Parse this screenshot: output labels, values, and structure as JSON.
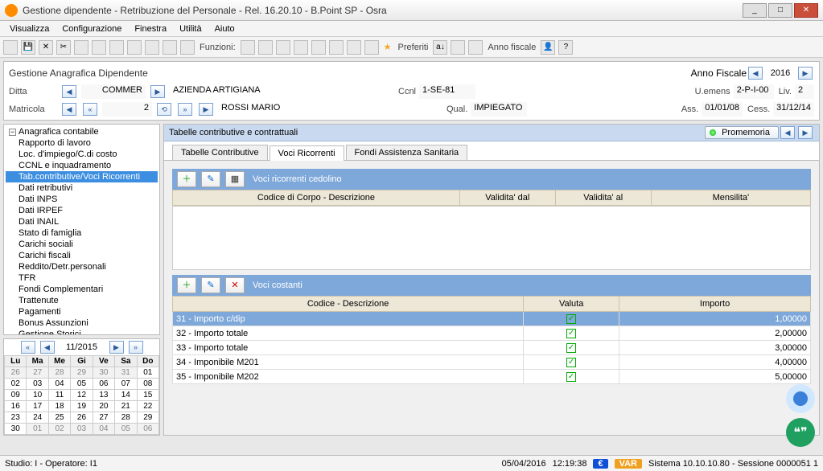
{
  "window": {
    "title": "Gestione dipendente - Retribuzione del Personale - Rel. 16.20.10 - B.Point SP - Osra"
  },
  "menu": {
    "items": [
      "Visualizza",
      "Configurazione",
      "Finestra",
      "Utilità",
      "Aiuto"
    ]
  },
  "toolbar": {
    "funzioni": "Funzioni:",
    "preferiti": "Preferiti",
    "anno_fiscale": "Anno fiscale"
  },
  "header": {
    "title": "Gestione Anagrafica Dipendente",
    "anno_label": "Anno Fiscale",
    "anno_value": "2016",
    "ditta_label": "Ditta",
    "ditta_code": "COMMER",
    "ditta_name": "AZIENDA ARTIGIANA",
    "ccnl_label": "Ccnl",
    "ccnl_value": "1-SE-81",
    "uemens_label": "U.emens",
    "uemens_value": "2-P-I-00",
    "liv_label": "Liv.",
    "liv_value": "2",
    "matricola_label": "Matricola",
    "matricola_value": "2",
    "nome": "ROSSI MARIO",
    "qual_label": "Qual.",
    "qual_value": "IMPIEGATO",
    "ass_label": "Ass.",
    "ass_value": "01/01/08",
    "cess_label": "Cess.",
    "cess_value": "31/12/14"
  },
  "tree": {
    "root": "Anagrafica contabile",
    "items": [
      "Rapporto di lavoro",
      "Loc. d'impiego/C.di costo",
      "CCNL e inquadramento",
      "Tab.contributive/Voci Ricorrenti",
      "Dati retributivi",
      "Dati INPS",
      "Dati IRPEF",
      "Dati INAIL",
      "Stato di famiglia",
      "Carichi sociali",
      "Carichi fiscali",
      "Reddito/Detr.personali",
      "TFR",
      "Fondi Complementari",
      "Trattenute",
      "Pagamenti",
      "Bonus Assunzioni",
      "Gestione Storici"
    ],
    "selected_index": 3
  },
  "calendar": {
    "month": "11/2015",
    "days": [
      "Lu",
      "Ma",
      "Me",
      "Gi",
      "Ve",
      "Sa",
      "Do"
    ],
    "rows": [
      [
        "26",
        "27",
        "28",
        "29",
        "30",
        "31",
        "01"
      ],
      [
        "02",
        "03",
        "04",
        "05",
        "06",
        "07",
        "08"
      ],
      [
        "09",
        "10",
        "11",
        "12",
        "13",
        "14",
        "15"
      ],
      [
        "16",
        "17",
        "18",
        "19",
        "20",
        "21",
        "22"
      ],
      [
        "23",
        "24",
        "25",
        "26",
        "27",
        "28",
        "29"
      ],
      [
        "30",
        "01",
        "02",
        "03",
        "04",
        "05",
        "06"
      ]
    ]
  },
  "panel": {
    "title": "Tabelle contributive e contrattuali",
    "promemoria": "Promemoria",
    "tabs": [
      "Tabelle Contributive",
      "Voci Ricorrenti",
      "Fondi Assistenza Sanitaria"
    ],
    "active_tab": 1,
    "sub1": {
      "title": "Voci ricorrenti cedolino",
      "cols": [
        "Codice di Corpo - Descrizione",
        "Validita' dal",
        "Validita' al",
        "Mensilita'"
      ]
    },
    "sub2": {
      "title": "Voci costanti",
      "cols": [
        "Codice - Descrizione",
        "Valuta",
        "Importo"
      ],
      "rows": [
        {
          "desc": "31 - Importo c/dip",
          "valuta": true,
          "importo": "1,00000"
        },
        {
          "desc": "32 - Importo totale",
          "valuta": true,
          "importo": "2,00000"
        },
        {
          "desc": "33 - Importo totale",
          "valuta": true,
          "importo": "3,00000"
        },
        {
          "desc": "34 - Imponibile M201",
          "valuta": true,
          "importo": "4,00000"
        },
        {
          "desc": "35 - Imponibile M202",
          "valuta": true,
          "importo": "5,00000"
        }
      ]
    }
  },
  "status": {
    "left": "Studio: I - Operatore: I1",
    "date": "05/04/2016",
    "time": "12:19:38",
    "e": "€",
    "var": "VAR",
    "right": "Sistema 10.10.10.80 - Sessione 0000051 1"
  }
}
